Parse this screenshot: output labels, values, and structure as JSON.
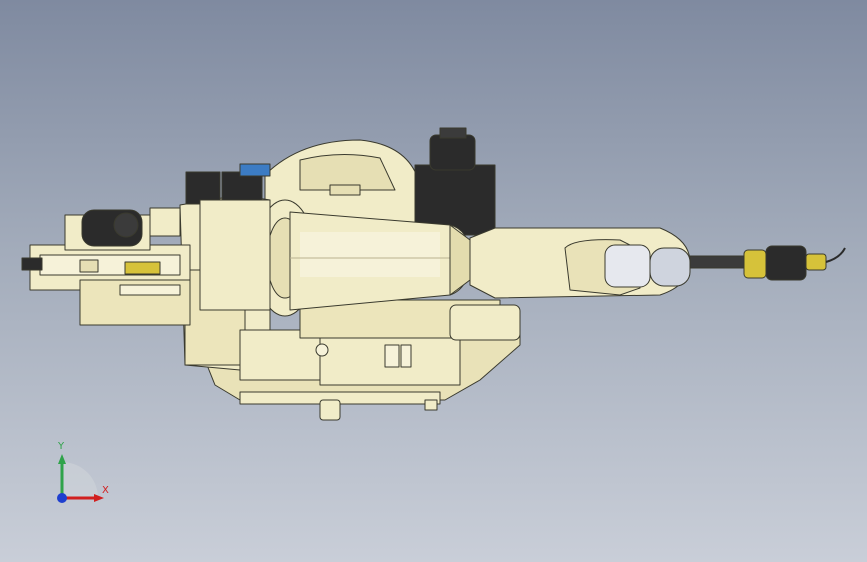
{
  "colors": {
    "background_top": "#7f8aa0",
    "background_bottom": "#c9ced8",
    "body": "#f1ecc8",
    "body_shadow": "#d8d1a6",
    "outline": "#3a3a2e",
    "dark_part": "#2b2b2b",
    "accent_yellow": "#d6c23a",
    "accent_blue": "#3c7cc4",
    "axis_x": "#d11f1f",
    "axis_y": "#2fa34a",
    "axis_z": "#1e3fcf"
  },
  "icons": {
    "triad": "coordinate-triad-icon",
    "model": "robot-arm-model"
  },
  "triad": {
    "x_label": "X",
    "y_label": "Y"
  }
}
